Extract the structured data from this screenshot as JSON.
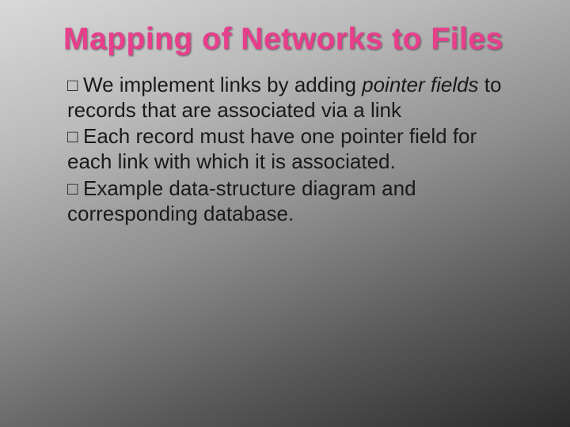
{
  "title": "Mapping of Networks to Files",
  "bullets": [
    {
      "pre": "We implement links by adding ",
      "em": "pointer fields",
      "post": " to records that are associated via a link"
    },
    {
      "pre": "Each record must have one pointer field for each link with which it is associated.",
      "em": "",
      "post": ""
    },
    {
      "pre": "Example data-structure diagram and corresponding database.",
      "em": "",
      "post": ""
    }
  ],
  "square": "□ "
}
